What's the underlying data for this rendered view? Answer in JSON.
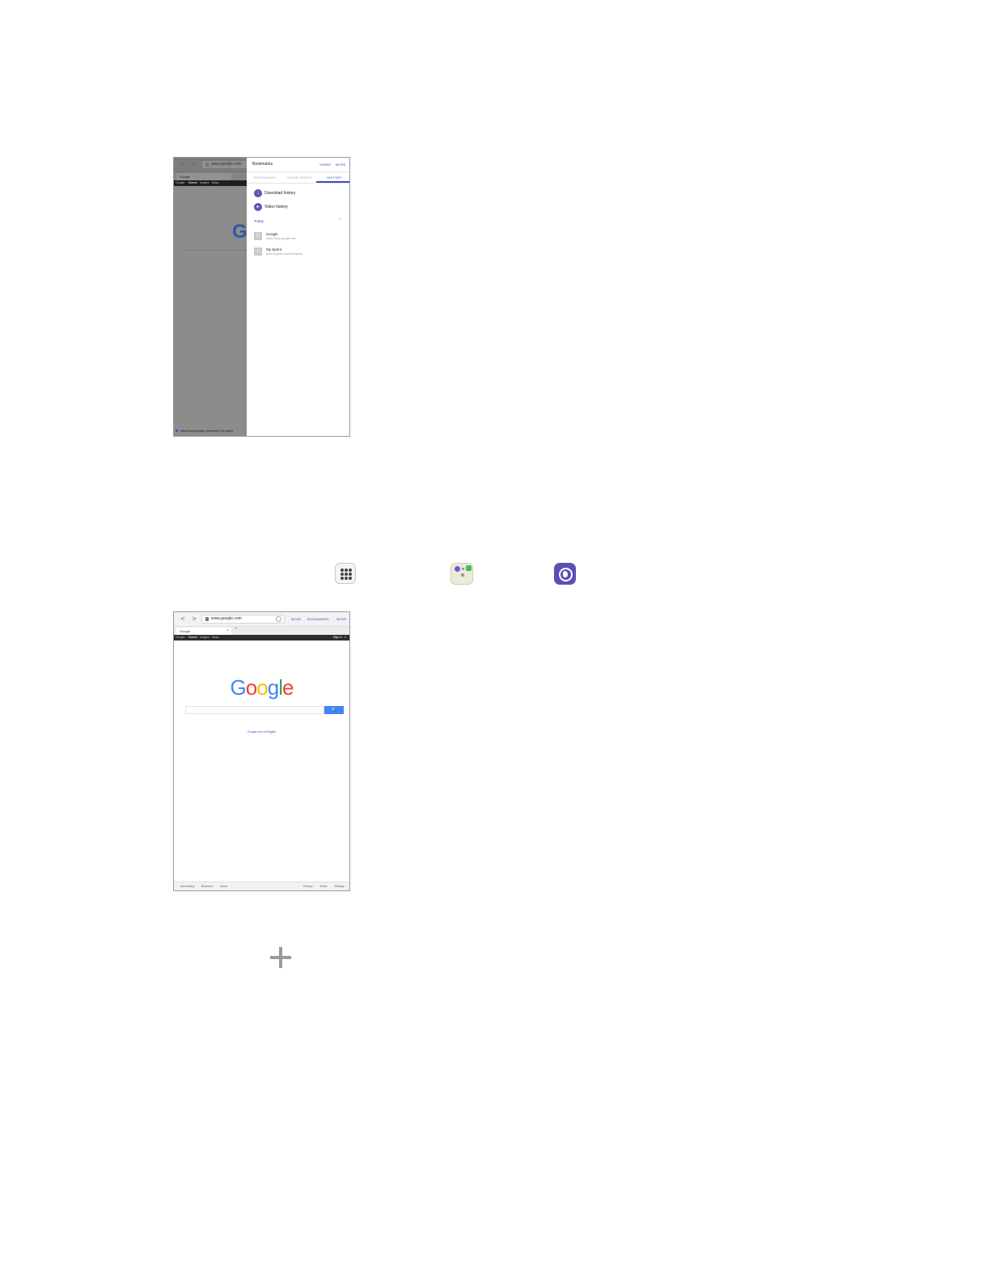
{
  "screenshot_history": {
    "toolbar": {
      "back": "<",
      "forward": ">",
      "url": "www.google.com"
    },
    "tab": {
      "title": "Google",
      "close": "×",
      "add": "+"
    },
    "google_bar": [
      "Google",
      "Search",
      "Images",
      "Maps"
    ],
    "page_logo_letter": "G",
    "status_url": "https://www.google.com/webhp?ref=sprint",
    "panel": {
      "title": "Bookmarks",
      "share_label": "SHARE",
      "more_label": "MORE",
      "tabs": [
        "BOOKMARKS",
        "SAVED PAGES",
        "HISTORY"
      ],
      "items": [
        {
          "label": "Download history",
          "icon": "download-history-icon"
        },
        {
          "label": "Video history",
          "icon": "video-history-icon"
        }
      ],
      "section": "Today",
      "section_chevron": "^",
      "entries": [
        {
          "favicon": "G",
          "title": "Google",
          "url": "https://www.google.com"
        },
        {
          "favicon": "S",
          "title": "My Sprint",
          "url": "www.mysprint.com/ref=sprint"
        }
      ]
    }
  },
  "launcher_icons": [
    "apps-icon",
    "samsung-folder-icon",
    "internet-icon"
  ],
  "screenshot_browser": {
    "toolbar": {
      "back": "<",
      "forward": ">",
      "url": "www.google.com",
      "mode_label": "MODE",
      "bookmarks_label": "BOOKMARKS",
      "more_label": "MORE"
    },
    "tab": {
      "title": "Google",
      "close": "×",
      "add": "+"
    },
    "google_bar": [
      "Google",
      "Search",
      "Images",
      "Maps"
    ],
    "sign_in": "Sign in",
    "logo": [
      "G",
      "o",
      "o",
      "g",
      "l",
      "e"
    ],
    "logo_colors": [
      "#4285f4",
      "#ea4335",
      "#fbbc05",
      "#4285f4",
      "#34a853",
      "#ea4335"
    ],
    "search_button": "🔍",
    "language_link": "Google.com in English",
    "footer_left": [
      "Advertising",
      "Business",
      "About"
    ],
    "footer_right": [
      "Privacy",
      "Terms",
      "Settings"
    ]
  },
  "plus_icon": "add-icon"
}
